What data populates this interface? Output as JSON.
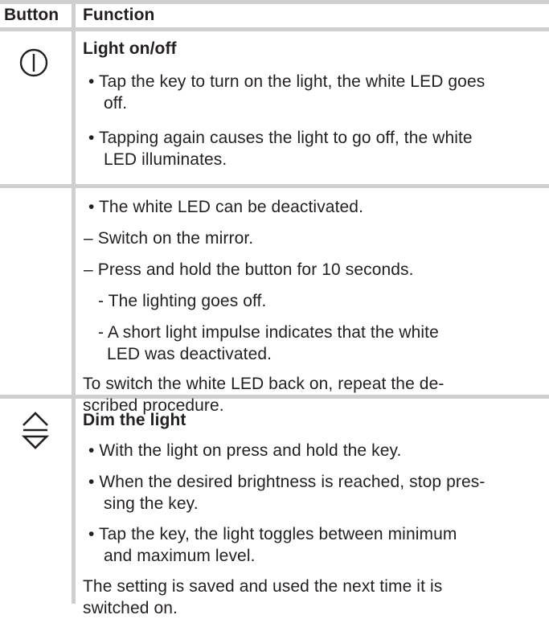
{
  "header": {
    "col_button": "Button",
    "col_function": "Function"
  },
  "rows": [
    {
      "icon": "power-icon",
      "title": "Light on/off",
      "lines": [
        "• Tap the key to turn on the light, the white LED goes",
        "off.",
        "• Tapping again causes the light to go off, the white",
        "LED illuminates."
      ]
    },
    {
      "lines": [
        "• The white LED can be deactivated.",
        "– Switch on the mirror.",
        "– Press and hold the button for 10 seconds.",
        "- The lighting goes off.",
        "- A short light impulse indicates that the white",
        "LED was deactivated.",
        "To switch the white LED back on, repeat the de-",
        "scribed procedure."
      ]
    },
    {
      "icon": "up-down-arrows-icon",
      "title": "Dim the light",
      "lines": [
        "• With the light on press and hold the key.",
        "• When the desired brightness is reached, stop pres-",
        "sing the key.",
        "• Tap the key, the light toggles between minimum",
        "and maximum level.",
        "The setting is saved and used the next time it is",
        "switched on."
      ]
    }
  ]
}
